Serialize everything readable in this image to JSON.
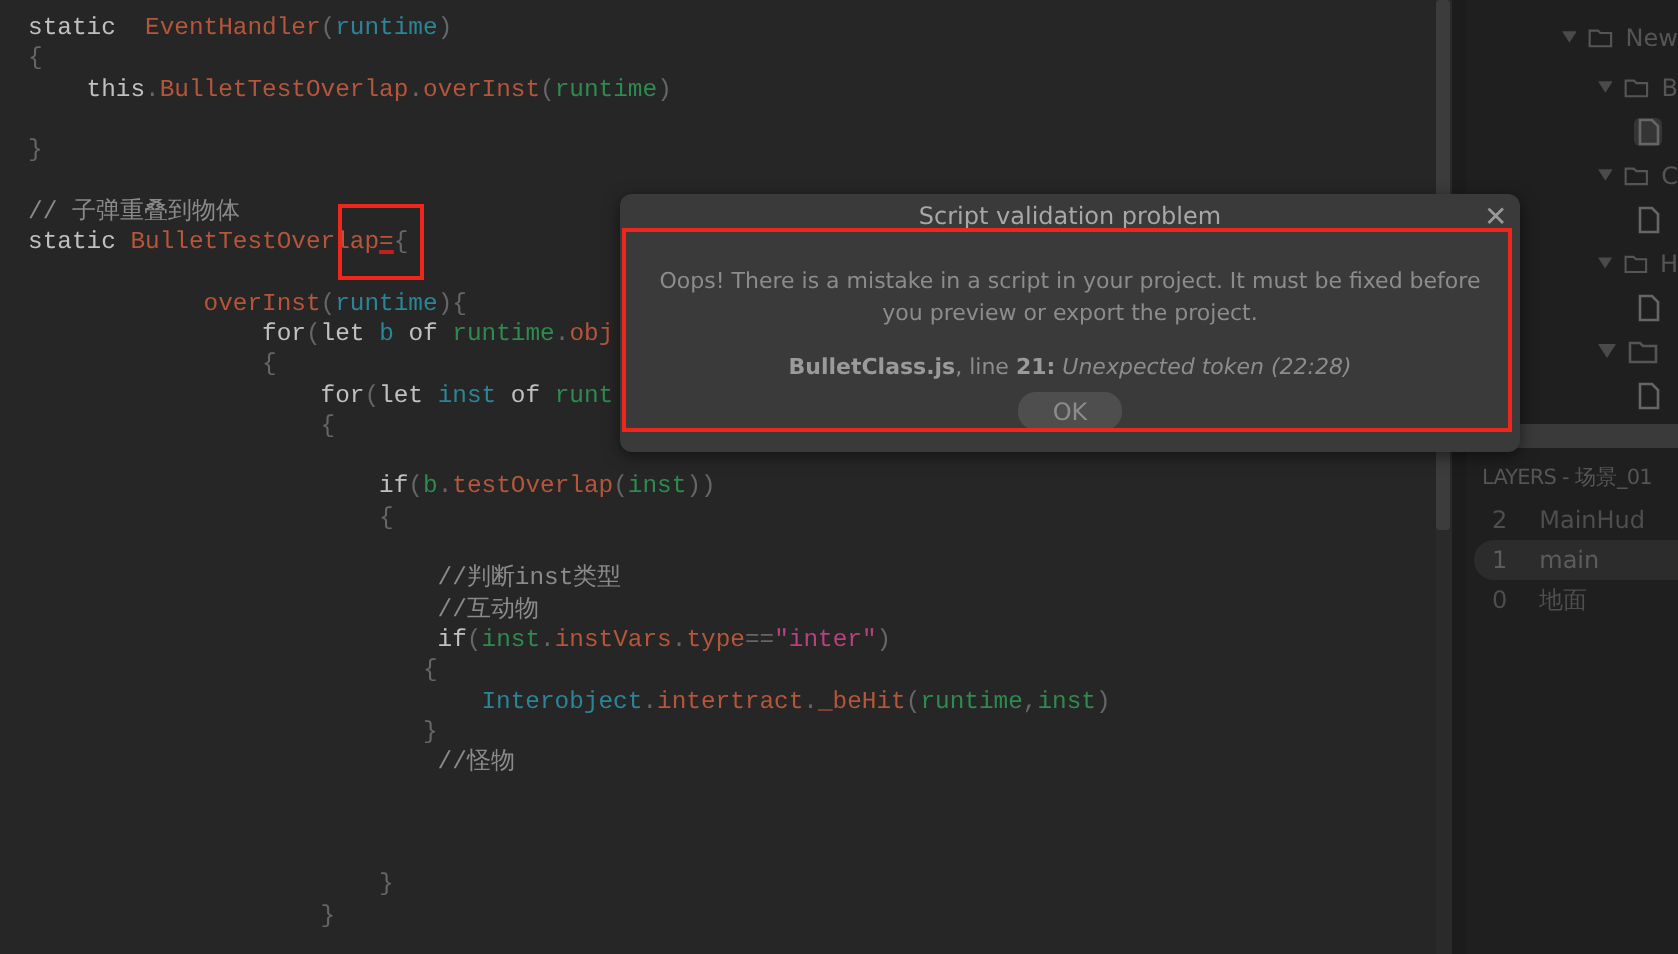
{
  "editor": {
    "lines": [
      {
        "kind": "code",
        "tokens": [
          {
            "kind": "kw",
            "text": "static  "
          },
          {
            "kind": "fn",
            "text": "EventHandler"
          },
          {
            "kind": "punct",
            "text": "("
          },
          {
            "kind": "param",
            "text": "runtime"
          },
          {
            "kind": "punct",
            "text": ")"
          }
        ]
      },
      {
        "kind": "code",
        "tokens": [
          {
            "kind": "punct",
            "text": "{"
          }
        ]
      },
      {
        "kind": "code",
        "tokens": [
          {
            "kind": "kw",
            "text": "    this"
          },
          {
            "kind": "punct",
            "text": "."
          },
          {
            "kind": "fn",
            "text": "BulletTestOverlap"
          },
          {
            "kind": "punct",
            "text": "."
          },
          {
            "kind": "fn",
            "text": "overInst"
          },
          {
            "kind": "punct",
            "text": "("
          },
          {
            "kind": "var",
            "text": "runtime"
          },
          {
            "kind": "punct",
            "text": ")"
          }
        ]
      },
      {
        "kind": "blank"
      },
      {
        "kind": "code",
        "tokens": [
          {
            "kind": "punct",
            "text": "}"
          }
        ]
      },
      {
        "kind": "blank"
      },
      {
        "kind": "code",
        "tokens": [
          {
            "kind": "comment",
            "text": "// 子弹重叠到物体"
          }
        ]
      },
      {
        "kind": "code",
        "tokens": [
          {
            "kind": "kw",
            "text": "static "
          },
          {
            "kind": "fn",
            "text": "BulletTestOverlap"
          },
          {
            "kind": "error",
            "text": "="
          },
          {
            "kind": "punct",
            "text": "{"
          }
        ]
      },
      {
        "kind": "blank"
      },
      {
        "kind": "code",
        "tokens": [
          {
            "kind": "fn",
            "text": "            overInst"
          },
          {
            "kind": "punct",
            "text": "("
          },
          {
            "kind": "param",
            "text": "runtime"
          },
          {
            "kind": "punct",
            "text": "){"
          }
        ]
      },
      {
        "kind": "code",
        "tokens": [
          {
            "kind": "kw",
            "text": "                for"
          },
          {
            "kind": "punct",
            "text": "("
          },
          {
            "kind": "kw",
            "text": "let "
          },
          {
            "kind": "param",
            "text": "b"
          },
          {
            "kind": "kw",
            "text": " of "
          },
          {
            "kind": "var",
            "text": "runtime"
          },
          {
            "kind": "punct",
            "text": "."
          },
          {
            "kind": "fn",
            "text": "obj"
          }
        ]
      },
      {
        "kind": "code",
        "tokens": [
          {
            "kind": "punct",
            "text": "                {"
          }
        ]
      },
      {
        "kind": "code",
        "tokens": [
          {
            "kind": "kw",
            "text": "                    for"
          },
          {
            "kind": "punct",
            "text": "("
          },
          {
            "kind": "kw",
            "text": "let "
          },
          {
            "kind": "param",
            "text": "inst"
          },
          {
            "kind": "kw",
            "text": " of "
          },
          {
            "kind": "var",
            "text": "runt"
          }
        ]
      },
      {
        "kind": "code",
        "tokens": [
          {
            "kind": "punct",
            "text": "                    {"
          }
        ]
      },
      {
        "kind": "blank"
      },
      {
        "kind": "code",
        "tokens": [
          {
            "kind": "kw",
            "text": "                        if"
          },
          {
            "kind": "punct",
            "text": "("
          },
          {
            "kind": "var",
            "text": "b"
          },
          {
            "kind": "punct",
            "text": "."
          },
          {
            "kind": "fn",
            "text": "testOverlap"
          },
          {
            "kind": "punct",
            "text": "("
          },
          {
            "kind": "var",
            "text": "inst"
          },
          {
            "kind": "punct",
            "text": "))"
          }
        ]
      },
      {
        "kind": "code",
        "tokens": [
          {
            "kind": "punct",
            "text": "                        {"
          }
        ]
      },
      {
        "kind": "blank"
      },
      {
        "kind": "code",
        "tokens": [
          {
            "kind": "comment",
            "text": "                            //判断inst类型"
          }
        ]
      },
      {
        "kind": "code",
        "tokens": [
          {
            "kind": "comment",
            "text": "                            //互动物"
          }
        ]
      },
      {
        "kind": "code",
        "tokens": [
          {
            "kind": "kw",
            "text": "                            if"
          },
          {
            "kind": "punct",
            "text": "("
          },
          {
            "kind": "var",
            "text": "inst"
          },
          {
            "kind": "punct",
            "text": "."
          },
          {
            "kind": "fn",
            "text": "instVars"
          },
          {
            "kind": "punct",
            "text": "."
          },
          {
            "kind": "fn",
            "text": "type"
          },
          {
            "kind": "punct",
            "text": "=="
          },
          {
            "kind": "str",
            "text": "\"inter\""
          },
          {
            "kind": "punct",
            "text": ")"
          }
        ]
      },
      {
        "kind": "code",
        "tokens": [
          {
            "kind": "punct",
            "text": "                           {"
          }
        ]
      },
      {
        "kind": "code",
        "tokens": [
          {
            "kind": "param",
            "text": "                               Interobject"
          },
          {
            "kind": "punct",
            "text": "."
          },
          {
            "kind": "fn",
            "text": "intertract"
          },
          {
            "kind": "punct",
            "text": "."
          },
          {
            "kind": "fn",
            "text": "_beHit"
          },
          {
            "kind": "punct",
            "text": "("
          },
          {
            "kind": "var",
            "text": "runtime"
          },
          {
            "kind": "punct",
            "text": ","
          },
          {
            "kind": "var",
            "text": "inst"
          },
          {
            "kind": "punct",
            "text": ")"
          }
        ]
      },
      {
        "kind": "code",
        "tokens": [
          {
            "kind": "punct",
            "text": "                           }"
          }
        ]
      },
      {
        "kind": "code",
        "tokens": [
          {
            "kind": "comment",
            "text": "                            //怪物"
          }
        ]
      },
      {
        "kind": "blank"
      },
      {
        "kind": "blank"
      },
      {
        "kind": "blank"
      },
      {
        "kind": "code",
        "tokens": [
          {
            "kind": "punct",
            "text": "                        }"
          }
        ]
      },
      {
        "kind": "code",
        "tokens": [
          {
            "kind": "punct",
            "text": "                    }"
          }
        ]
      }
    ]
  },
  "project_tree": [
    {
      "label": "New",
      "expanded": true,
      "children": [
        {
          "label": "B",
          "expanded": true,
          "children": [
            {
              "kind": "file",
              "selected": true
            }
          ]
        },
        {
          "label": "C",
          "expanded": true,
          "children": [
            {
              "kind": "file",
              "selected": false
            }
          ]
        },
        {
          "label": "H",
          "expanded": true,
          "children": [
            {
              "kind": "file",
              "selected": false
            }
          ]
        },
        {
          "expanded": true,
          "children": [
            {
              "kind": "file",
              "selected": false
            }
          ]
        }
      ]
    }
  ],
  "layers": {
    "title": "LAYERS - 场景_01",
    "items": [
      {
        "index": "2",
        "name": "MainHud",
        "selected": false
      },
      {
        "index": "1",
        "name": "main",
        "selected": true
      },
      {
        "index": "0",
        "name": "地面",
        "selected": false
      }
    ]
  },
  "dialog": {
    "title": "Script validation problem",
    "close": "✕",
    "message": "Oops! There is a mistake in a script in your project. It must be fixed before you preview or export the project.",
    "error": "**BulletClass.js**, line **21:** *Unexpected token (22:28)*",
    "button": "OK"
  }
}
